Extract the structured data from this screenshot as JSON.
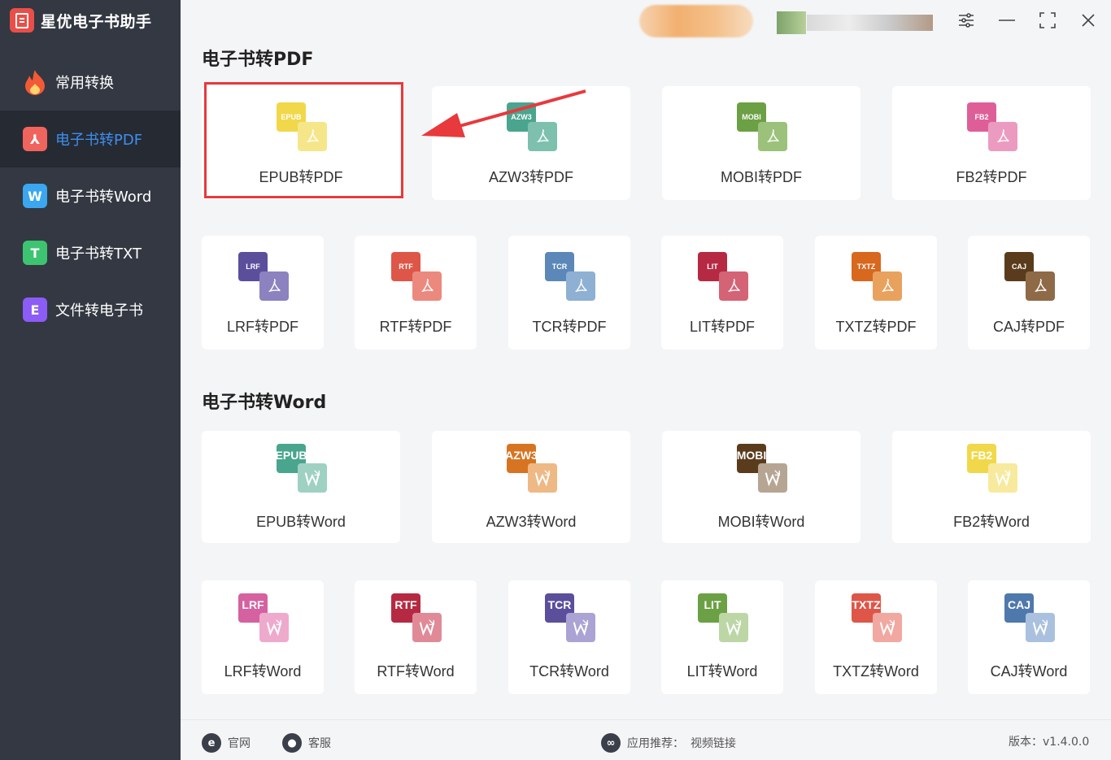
{
  "app": {
    "title": "星优电子书助手"
  },
  "sidebar": {
    "items": [
      {
        "label": "常用转换",
        "color": "#f25a36",
        "glyph": "",
        "icon": "flame-icon"
      },
      {
        "label": "电子书转PDF",
        "color": "#f0645e",
        "glyph": "⅄",
        "icon": "pdf-icon"
      },
      {
        "label": "电子书转Word",
        "color": "#3aa7f0",
        "glyph": "W",
        "icon": "word-icon"
      },
      {
        "label": "电子书转TXT",
        "color": "#3dc470",
        "glyph": "T",
        "icon": "txt-icon"
      },
      {
        "label": "文件转电子书",
        "color": "#8b5cf6",
        "glyph": "E",
        "icon": "ebook-icon"
      }
    ]
  },
  "sections": {
    "pdf_title": "电子书转PDF",
    "word_title": "电子书转Word"
  },
  "pdf_cards": [
    {
      "label": "EPUB转PDF",
      "tag": "EPUB",
      "back": "#f0d84a",
      "front": "#f5e68a"
    },
    {
      "label": "AZW3转PDF",
      "tag": "AZW3",
      "back": "#4aa58e",
      "front": "#7cc0ad"
    },
    {
      "label": "MOBI转PDF",
      "tag": "MOBI",
      "back": "#6ba044",
      "front": "#9bc17b"
    },
    {
      "label": "FB2转PDF",
      "tag": "FB2",
      "back": "#de5f98",
      "front": "#ec9bc0"
    },
    {
      "label": "LRF转PDF",
      "tag": "LRF",
      "back": "#5b4f9c",
      "front": "#8c82bf"
    },
    {
      "label": "RTF转PDF",
      "tag": "RTF",
      "back": "#de5648",
      "front": "#ec897f"
    },
    {
      "label": "TCR转PDF",
      "tag": "TCR",
      "back": "#5b88b8",
      "front": "#8eb0d3"
    },
    {
      "label": "LIT转PDF",
      "tag": "LIT",
      "back": "#b52a42",
      "front": "#d46376"
    },
    {
      "label": "TXTZ转PDF",
      "tag": "TXTZ",
      "back": "#d7681e",
      "front": "#e9a25e"
    },
    {
      "label": "CAJ转PDF",
      "tag": "CAJ",
      "back": "#5a3c1c",
      "front": "#8e6a46"
    }
  ],
  "word_cards": [
    {
      "label": "EPUB转Word",
      "tag": "EPUB",
      "back": "#4aa58e",
      "front": "#9fd1c3"
    },
    {
      "label": "AZW3转Word",
      "tag": "AZW3",
      "back": "#d77422",
      "front": "#eeb985"
    },
    {
      "label": "MOBI转Word",
      "tag": "MOBI",
      "back": "#5a3c1c",
      "front": "#b7a593"
    },
    {
      "label": "FB2转Word",
      "tag": "FB2",
      "back": "#f0d84a",
      "front": "#f7ea9e"
    },
    {
      "label": "LRF转Word",
      "tag": "LRF",
      "back": "#d561a0",
      "front": "#eeaacd"
    },
    {
      "label": "RTF转Word",
      "tag": "RTF",
      "back": "#b52a42",
      "front": "#e08a98"
    },
    {
      "label": "TCR转Word",
      "tag": "TCR",
      "back": "#5b4f9c",
      "front": "#aaa3d3"
    },
    {
      "label": "LIT转Word",
      "tag": "LIT",
      "back": "#6ba044",
      "front": "#bcd6a6"
    },
    {
      "label": "TXTZ转Word",
      "tag": "TXTZ",
      "back": "#de5648",
      "front": "#f1a8a0"
    },
    {
      "label": "CAJ转Word",
      "tag": "CAJ",
      "back": "#4f78ad",
      "front": "#a9c1de"
    }
  ],
  "footer": {
    "website": "官网",
    "service": "客服",
    "recommend_label": "应用推荐：",
    "video_link": "视频链接",
    "version": "版本：v1.4.0.0"
  },
  "annotation": {
    "highlight_color": "#e8393c"
  }
}
